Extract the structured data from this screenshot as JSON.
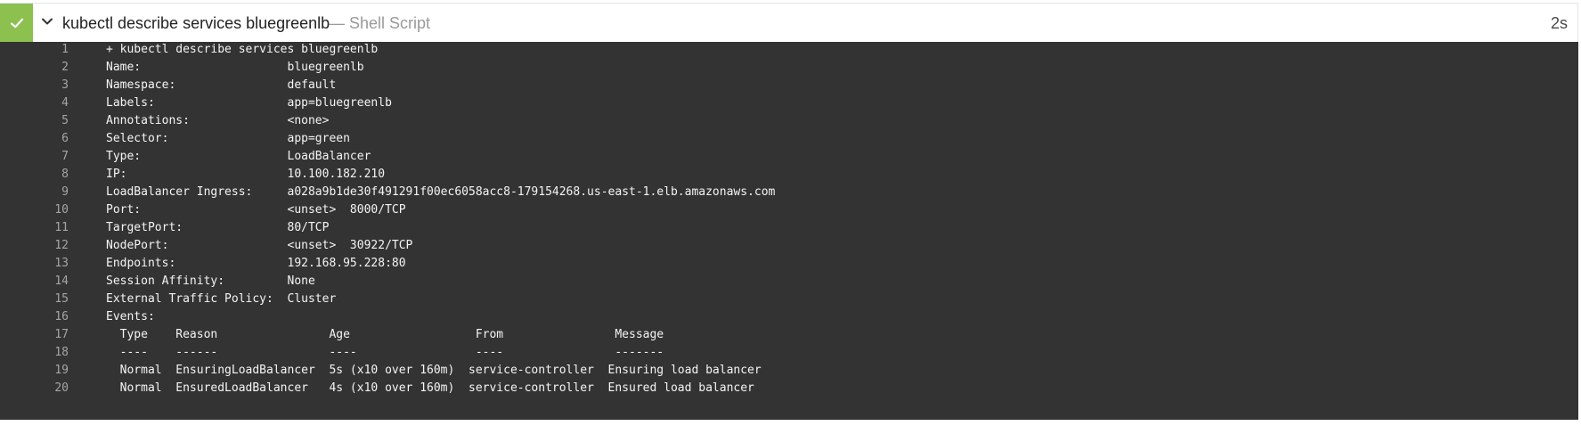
{
  "header": {
    "title": "kubectl describe services bluegreenlb",
    "type_label": "— Shell Script",
    "duration": "2s",
    "colors": {
      "success": "#8cc04f",
      "log_background": "#333333"
    },
    "icons": {
      "status": "check-icon",
      "toggle": "chevron-down-icon"
    }
  },
  "log": {
    "lines": [
      {
        "number": "1",
        "text": "+ kubectl describe services bluegreenlb"
      },
      {
        "number": "2",
        "text": "Name:                     bluegreenlb"
      },
      {
        "number": "3",
        "text": "Namespace:                default"
      },
      {
        "number": "4",
        "text": "Labels:                   app=bluegreenlb"
      },
      {
        "number": "5",
        "text": "Annotations:              <none>"
      },
      {
        "number": "6",
        "text": "Selector:                 app=green"
      },
      {
        "number": "7",
        "text": "Type:                     LoadBalancer"
      },
      {
        "number": "8",
        "text": "IP:                       10.100.182.210"
      },
      {
        "number": "9",
        "text": "LoadBalancer Ingress:     a028a9b1de30f491291f00ec6058acc8-179154268.us-east-1.elb.amazonaws.com"
      },
      {
        "number": "10",
        "text": "Port:                     <unset>  8000/TCP"
      },
      {
        "number": "11",
        "text": "TargetPort:               80/TCP"
      },
      {
        "number": "12",
        "text": "NodePort:                 <unset>  30922/TCP"
      },
      {
        "number": "13",
        "text": "Endpoints:                192.168.95.228:80"
      },
      {
        "number": "14",
        "text": "Session Affinity:         None"
      },
      {
        "number": "15",
        "text": "External Traffic Policy:  Cluster"
      },
      {
        "number": "16",
        "text": "Events:"
      },
      {
        "number": "17",
        "text": "  Type    Reason                Age                  From                Message"
      },
      {
        "number": "18",
        "text": "  ----    ------                ----                 ----                -------"
      },
      {
        "number": "19",
        "text": "  Normal  EnsuringLoadBalancer  5s (x10 over 160m)  service-controller  Ensuring load balancer"
      },
      {
        "number": "20",
        "text": "  Normal  EnsuredLoadBalancer   4s (x10 over 160m)  service-controller  Ensured load balancer"
      }
    ]
  }
}
